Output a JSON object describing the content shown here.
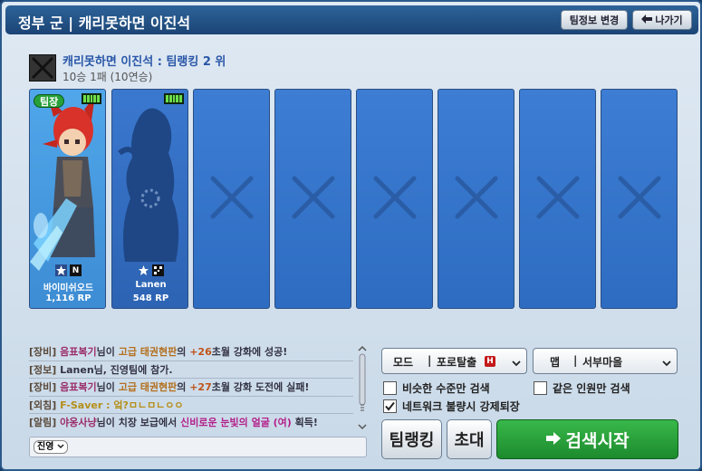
{
  "window": {
    "title": "정부 군 | 캐리못하면 이진석",
    "team_info_button": "팀정보 변경",
    "leave_button": "나가기"
  },
  "team": {
    "name": "캐리못하면 이진석 : 팀랭킹 2 위",
    "record": "10승 1패 (10연승)"
  },
  "players": [
    {
      "leader_label": "팀장",
      "name": "바이미쉬오드",
      "rp": "1,116 RP",
      "badge_letter": "N"
    },
    {
      "name": "Lanen",
      "rp": "548 RP"
    }
  ],
  "empty_slot_count": 6,
  "chat": {
    "lines": [
      {
        "tag": "[장비]",
        "parts": [
          {
            "t": " ",
            "c": "sys"
          },
          {
            "t": "음표복기",
            "c": "name"
          },
          {
            "t": "님이 ",
            "c": "sys"
          },
          {
            "t": "고급 태권현판",
            "c": "item"
          },
          {
            "t": "의 ",
            "c": "sys"
          },
          {
            "t": "+26",
            "c": "num"
          },
          {
            "t": "초월 강화에 성공!",
            "c": "sys"
          }
        ]
      },
      {
        "tag": "[정보]",
        "parts": [
          {
            "t": " Lanen님, 진영팀에 참가.",
            "c": "sys"
          }
        ]
      },
      {
        "tag": "[장비]",
        "parts": [
          {
            "t": " ",
            "c": "sys"
          },
          {
            "t": "음표복기",
            "c": "name"
          },
          {
            "t": "님이 ",
            "c": "sys"
          },
          {
            "t": "고급 태권현판",
            "c": "item"
          },
          {
            "t": "의 ",
            "c": "sys"
          },
          {
            "t": "+27",
            "c": "num"
          },
          {
            "t": "초월 강화 도전에 실패!",
            "c": "sys"
          }
        ]
      },
      {
        "tag": "[외침]",
        "parts": [
          {
            "t": " F-Saver : 엌?ㅁㄴㅁㄴㅇㅇ",
            "c": "shout"
          }
        ]
      },
      {
        "tag": "[알림]",
        "parts": [
          {
            "t": " ",
            "c": "sys"
          },
          {
            "t": "야옹사냥",
            "c": "name"
          },
          {
            "t": "님이 치장 보급에서 ",
            "c": "sys"
          },
          {
            "t": "신비로운 눈빛의 얼굴 (여)",
            "c": "rare"
          },
          {
            "t": " 획득!",
            "c": "sys"
          }
        ]
      }
    ],
    "channel": "진영"
  },
  "controls": {
    "mode_label": "모드",
    "mode_value": "포로탈출",
    "map_label": "맵",
    "map_value": "서부마을",
    "similar_level_label": "비슷한 수준만 검색",
    "similar_level_checked": false,
    "same_count_label": "같은 인원만 검색",
    "same_count_checked": false,
    "network_kick_label": "네트워크 불량시 강제퇴장",
    "network_kick_checked": true,
    "team_rank_button": "팀랭킹",
    "invite_button": "초대",
    "search_button": "검색시작"
  }
}
